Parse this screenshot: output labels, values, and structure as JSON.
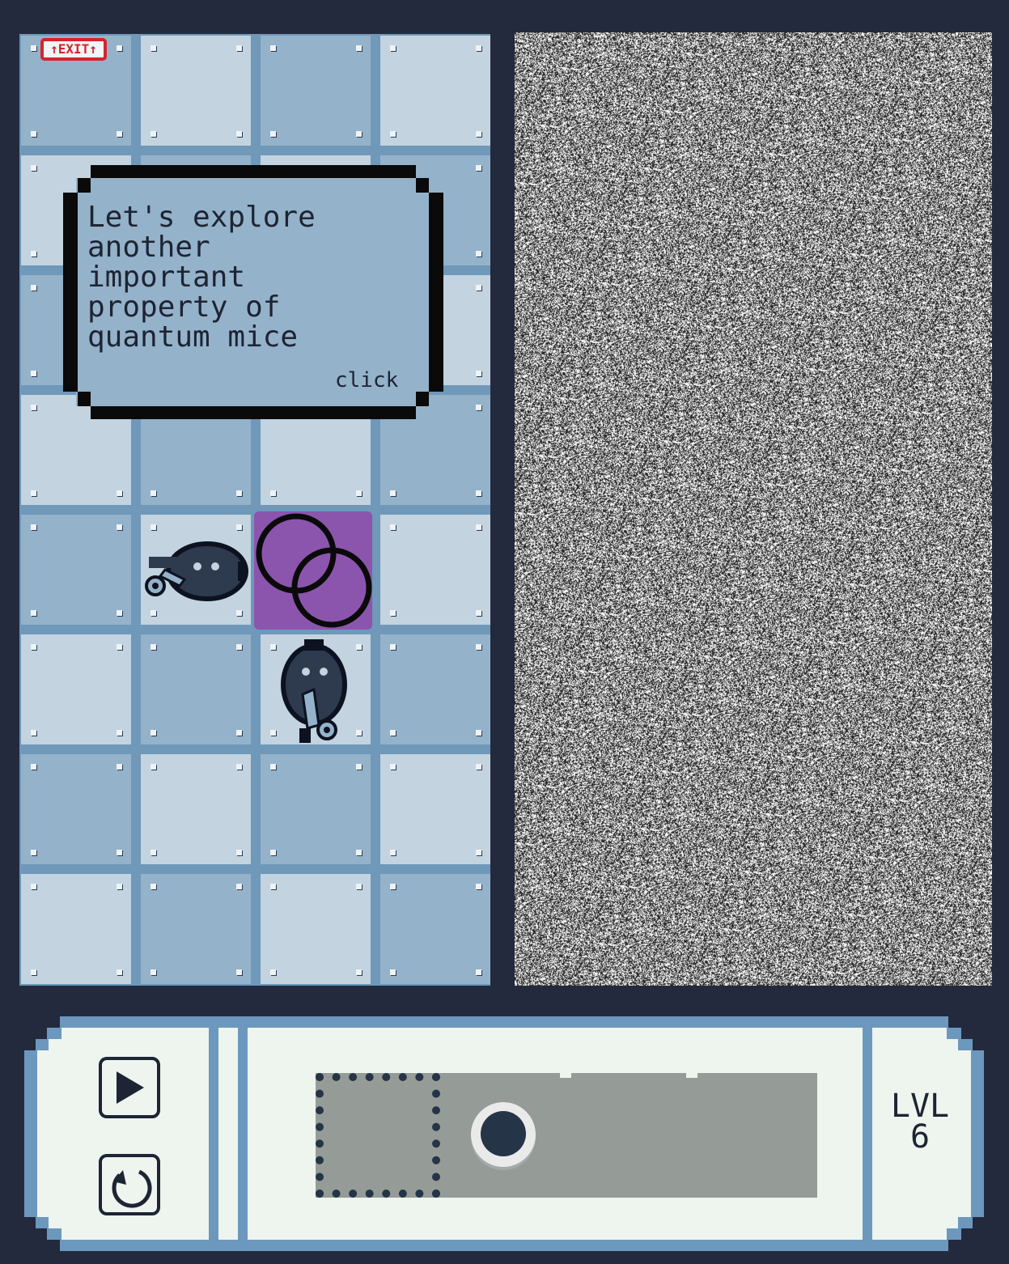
{
  "exit_sign": {
    "label": "↑EXIT↑"
  },
  "dialog": {
    "text": "Let's explore\nanother\nimportant\nproperty of\nquantum mice",
    "hint": "click"
  },
  "controls": {
    "play_icon": "play-icon",
    "restart_icon": "restart-icon"
  },
  "level": {
    "label": "LVL",
    "number": "6"
  },
  "colors": {
    "board_light": "#c3d3e0",
    "board_dark": "#94b2c9",
    "grout": "#6f98b9",
    "background": "#232a3d",
    "quantum_gate": "#8b55ae",
    "exit_red": "#d8232d",
    "panel_bg": "#eef4ee",
    "track": "#959b97"
  }
}
